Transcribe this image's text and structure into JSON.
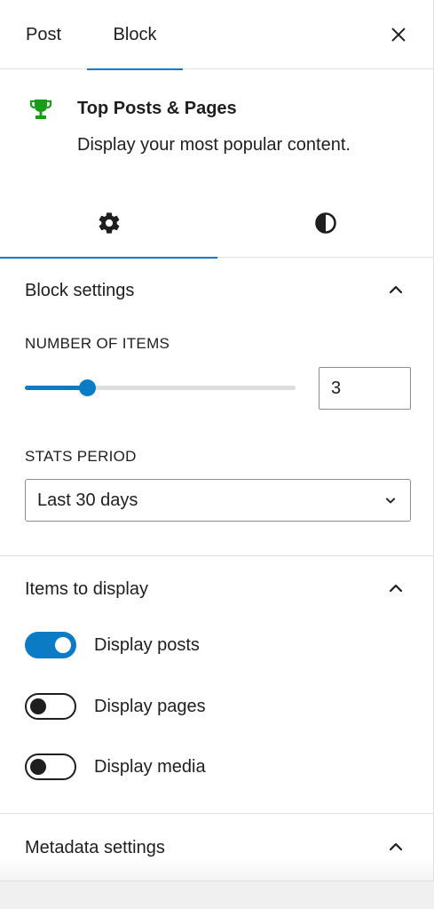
{
  "header": {
    "tabs": [
      {
        "label": "Post"
      },
      {
        "label": "Block"
      }
    ]
  },
  "block_card": {
    "title": "Top Posts & Pages",
    "description": "Display your most popular content.",
    "icon": "trophy-icon",
    "icon_color": "#1a9c1a"
  },
  "subtabs": [
    {
      "icon": "gear-icon"
    },
    {
      "icon": "contrast-icon"
    }
  ],
  "block_settings": {
    "title": "Block settings",
    "number_of_items": {
      "label": "NUMBER OF ITEMS",
      "value": "3",
      "slider_fraction": 0.23
    },
    "stats_period": {
      "label": "STATS PERIOD",
      "selected": "Last 30 days"
    }
  },
  "items_to_display": {
    "title": "Items to display",
    "toggles": [
      {
        "label": "Display posts",
        "checked": true
      },
      {
        "label": "Display pages",
        "checked": false
      },
      {
        "label": "Display media",
        "checked": false
      }
    ]
  },
  "metadata_settings": {
    "title": "Metadata settings"
  },
  "colors": {
    "accent": "#0a7bc4",
    "text": "#1e1e1e",
    "border": "#e0e0e0"
  }
}
